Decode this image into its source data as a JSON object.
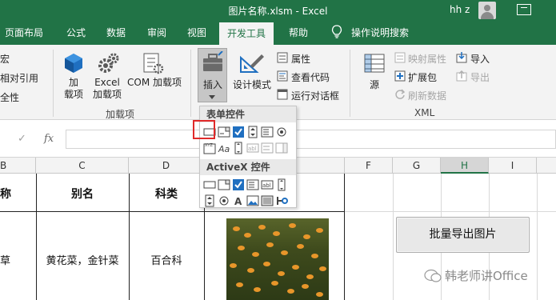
{
  "window": {
    "title": "图片名称.xlsm  -  Excel",
    "user": "hh z"
  },
  "tabs": [
    {
      "label": "页面布局"
    },
    {
      "label": "公式"
    },
    {
      "label": "数据"
    },
    {
      "label": "审阅"
    },
    {
      "label": "视图"
    },
    {
      "label": "开发工具",
      "active": true
    },
    {
      "label": "帮助"
    },
    {
      "label": "操作说明搜索"
    }
  ],
  "ribbon": {
    "code_group": {
      "items": [
        "宏",
        "相对引用",
        "全性"
      ]
    },
    "addins_group": {
      "label": "加载项",
      "addins_btn": "加\n载项",
      "excel_addins_btn": "Excel\n加载项",
      "com_addins_btn": "COM 加载项"
    },
    "controls_group": {
      "insert_btn": "插入",
      "design_mode_btn": "设计模式",
      "properties": "属性",
      "view_code": "查看代码",
      "run_dialog": "运行对话框"
    },
    "xml_group": {
      "label": "XML",
      "source": "源",
      "map_properties": "映射属性",
      "expansion_packs": "扩展包",
      "refresh_data": "刷新数据",
      "import": "导入",
      "export": "导出"
    }
  },
  "formula_bar": {
    "cancel": "✓",
    "fx": "fx",
    "value": ""
  },
  "columns": [
    "B",
    "C",
    "D",
    "E",
    "F",
    "G",
    "H",
    "I"
  ],
  "selected_column": "H",
  "sheet": {
    "headers": [
      "称",
      "别名",
      "科类"
    ],
    "row1": [
      "草",
      "黄花菜，金针菜",
      "百合科"
    ]
  },
  "export_button": {
    "label": "批量导出图片"
  },
  "dropdown": {
    "form_controls_title": "表单控件",
    "activex_title": "ActiveX 控件"
  },
  "watermark": "韩老师讲Office",
  "colors": {
    "brand": "#217346",
    "highlight": "#e02a2a"
  }
}
